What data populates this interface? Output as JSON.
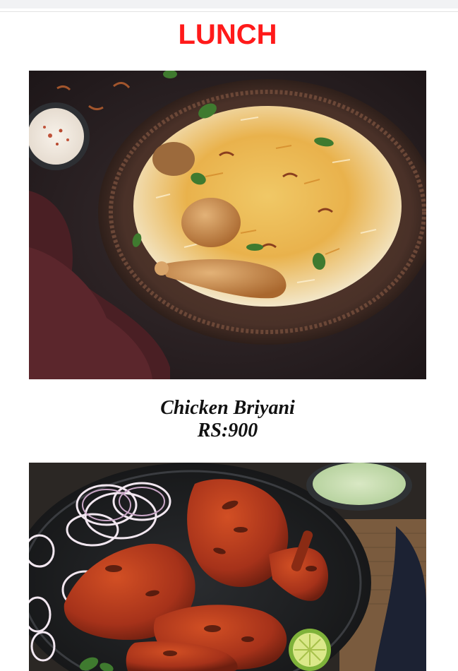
{
  "page": {
    "section_title": "LUNCH"
  },
  "menu": {
    "items": [
      {
        "name": "Chicken Briyani",
        "price": "RS:900",
        "icon": "biryani-photo"
      },
      {
        "name": "",
        "price": "",
        "icon": "tandoori-chicken-photo"
      }
    ]
  },
  "colors": {
    "title": "#ff1a1a",
    "caption": "#111111",
    "background": "#ffffff"
  }
}
